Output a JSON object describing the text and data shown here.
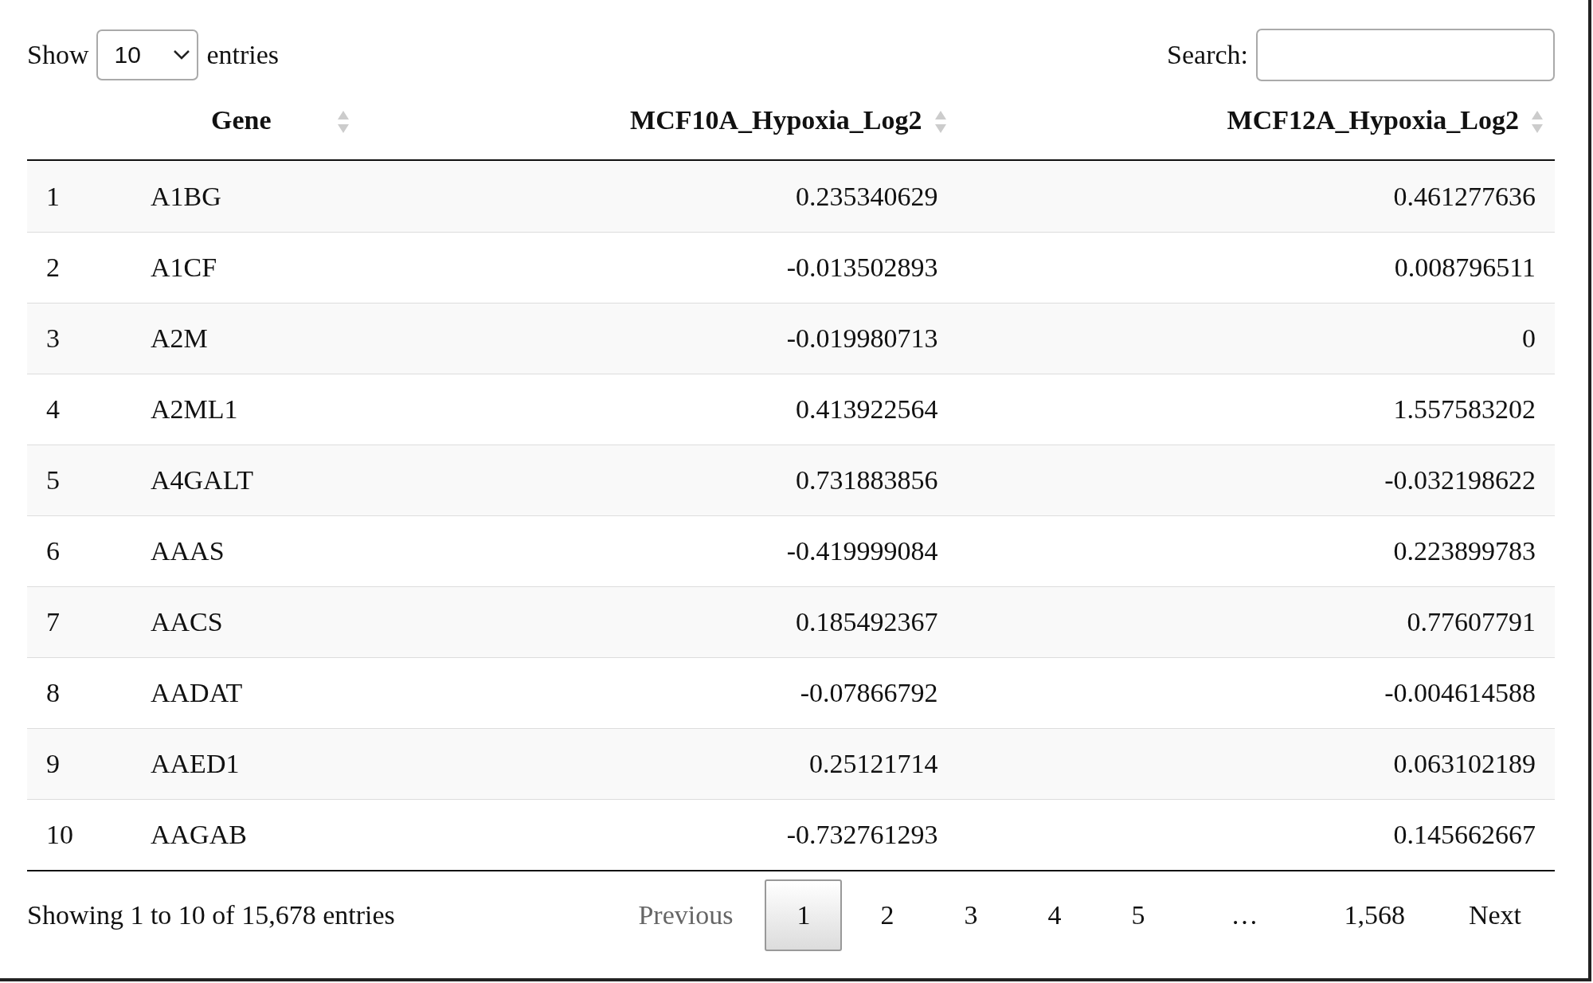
{
  "length_control": {
    "label_before": "Show",
    "value": "10",
    "label_after": "entries"
  },
  "search": {
    "label": "Search:"
  },
  "table": {
    "columns": [
      "Gene",
      "MCF10A_Hypoxia_Log2",
      "MCF12A_Hypoxia_Log2"
    ],
    "rows": [
      {
        "row_number": "1",
        "cells": [
          "A1BG",
          "0.235340629",
          "0.461277636"
        ]
      },
      {
        "row_number": "2",
        "cells": [
          "A1CF",
          "-0.013502893",
          "0.008796511"
        ]
      },
      {
        "row_number": "3",
        "cells": [
          "A2M",
          "-0.019980713",
          "0"
        ]
      },
      {
        "row_number": "4",
        "cells": [
          "A2ML1",
          "0.413922564",
          "1.557583202"
        ]
      },
      {
        "row_number": "5",
        "cells": [
          "A4GALT",
          "0.731883856",
          "-0.032198622"
        ]
      },
      {
        "row_number": "6",
        "cells": [
          "AAAS",
          "-0.419999084",
          "0.223899783"
        ]
      },
      {
        "row_number": "7",
        "cells": [
          "AACS",
          "0.185492367",
          "0.77607791"
        ]
      },
      {
        "row_number": "8",
        "cells": [
          "AADAT",
          "-0.07866792",
          "-0.004614588"
        ]
      },
      {
        "row_number": "9",
        "cells": [
          "AAED1",
          "0.25121714",
          "0.063102189"
        ]
      },
      {
        "row_number": "10",
        "cells": [
          "AAGAB",
          "-0.732761293",
          "0.145662667"
        ]
      }
    ]
  },
  "info": "Showing 1 to 10 of 15,678 entries",
  "pagination": [
    {
      "label": "Previous",
      "kind": "nav",
      "selected": false,
      "disabled": true
    },
    {
      "label": "1",
      "kind": "page",
      "selected": true,
      "disabled": false
    },
    {
      "label": "2",
      "kind": "page",
      "selected": false,
      "disabled": false
    },
    {
      "label": "3",
      "kind": "page",
      "selected": false,
      "disabled": false
    },
    {
      "label": "4",
      "kind": "page",
      "selected": false,
      "disabled": false
    },
    {
      "label": "5",
      "kind": "page",
      "selected": false,
      "disabled": false
    },
    {
      "label": "…",
      "kind": "ellipsis"
    },
    {
      "label": "1,568",
      "kind": "page",
      "selected": false,
      "disabled": false
    },
    {
      "label": "Next",
      "kind": "nav",
      "selected": false,
      "disabled": false
    }
  ]
}
